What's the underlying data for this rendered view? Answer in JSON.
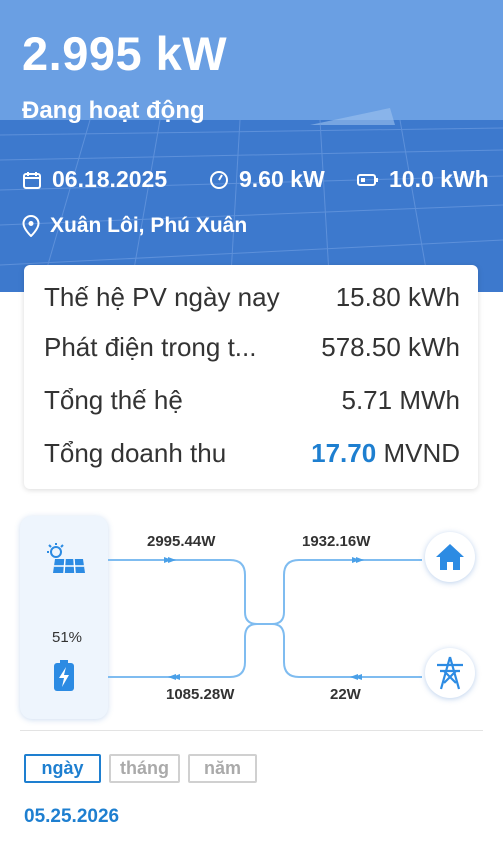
{
  "hero": {
    "power": "2.995 kW",
    "status": "Đang hoạt động",
    "date": "06.18.2025",
    "capacity": "9.60 kW",
    "battery_capacity": "10.0 kWh",
    "location": "Xuân Lôi, Phú Xuân",
    "icons": [
      "calendar-icon",
      "gauge-icon",
      "battery-icon",
      "location-pin-icon"
    ]
  },
  "stats": [
    {
      "label": "Thế hệ PV ngày nay",
      "value": "15.80 kWh"
    },
    {
      "label": "Phát điện trong t...",
      "value": "578.50 kWh"
    },
    {
      "label": "Tổng thế hệ",
      "value": "5.71 MWh"
    },
    {
      "label": "Tổng doanh thu",
      "value_number": "17.70",
      "value_unit": "MVND"
    }
  ],
  "flow": {
    "pv_to_center": "2995.44W",
    "center_to_home": "1932.16W",
    "center_to_battery": "1085.28W",
    "grid_flow": "22W",
    "battery_percent": "51%",
    "icons": [
      "solar-panel-icon",
      "battery-charging-icon",
      "home-icon",
      "power-tower-icon"
    ]
  },
  "tabs": [
    "ngày",
    "tháng",
    "năm"
  ],
  "active_tab": "ngày",
  "selected_date": "05.25.2026",
  "colors": {
    "accent": "#1e7fd0",
    "hero": "#4a87d8",
    "flow_line": "#7fbcf0"
  }
}
